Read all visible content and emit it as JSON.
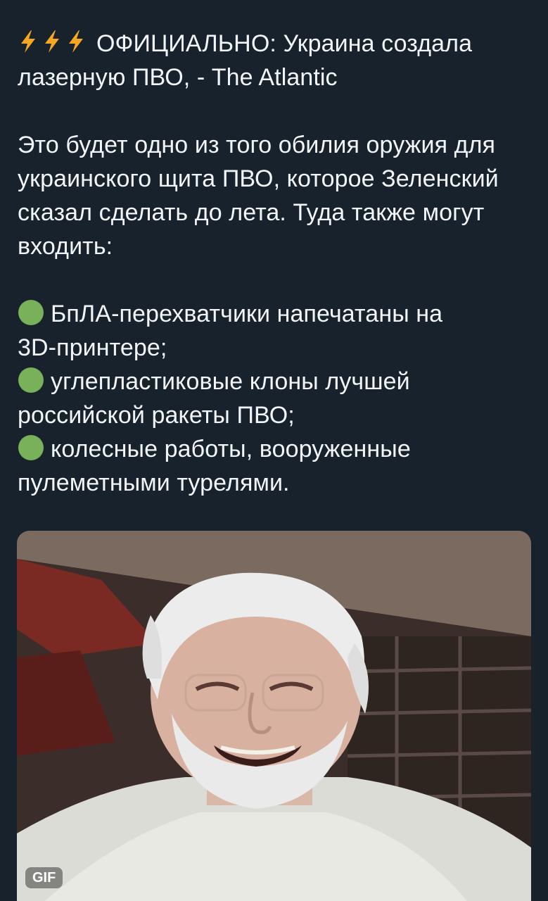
{
  "colors": {
    "background": "#18222d",
    "text": "#f2f5f8",
    "bolt": "#f5a623",
    "bullet": "#78b159"
  },
  "post": {
    "headline_icons": [
      "lightning-icon",
      "lightning-icon",
      "lightning-icon"
    ],
    "headline_lines": [
      "ОФИЦИАЛЬНО: Украина создала",
      "лазерную ПВО, - The Atlantic"
    ],
    "body_lines": [
      "Это будет одно из того обилия оружия для",
      "украинского щита ПВО, которое Зеленский",
      "сказал сделать до лета. Туда также могут",
      "входить:"
    ],
    "bullets": [
      {
        "icon": "green-circle-icon",
        "first_line": "БпЛА-перехватчики напечатаны на",
        "second_line": "3D-принтере;"
      },
      {
        "icon": "green-circle-icon",
        "first_line": "углепластиковые клоны лучшей",
        "second_line": "российской ракеты ПВО;"
      },
      {
        "icon": "green-circle-icon",
        "first_line": "колесные работы, вооруженные",
        "second_line": "пулеметными турелями."
      }
    ]
  },
  "media": {
    "type": "gif",
    "badge": "GIF",
    "description_icon": "gif-thumbnail"
  }
}
